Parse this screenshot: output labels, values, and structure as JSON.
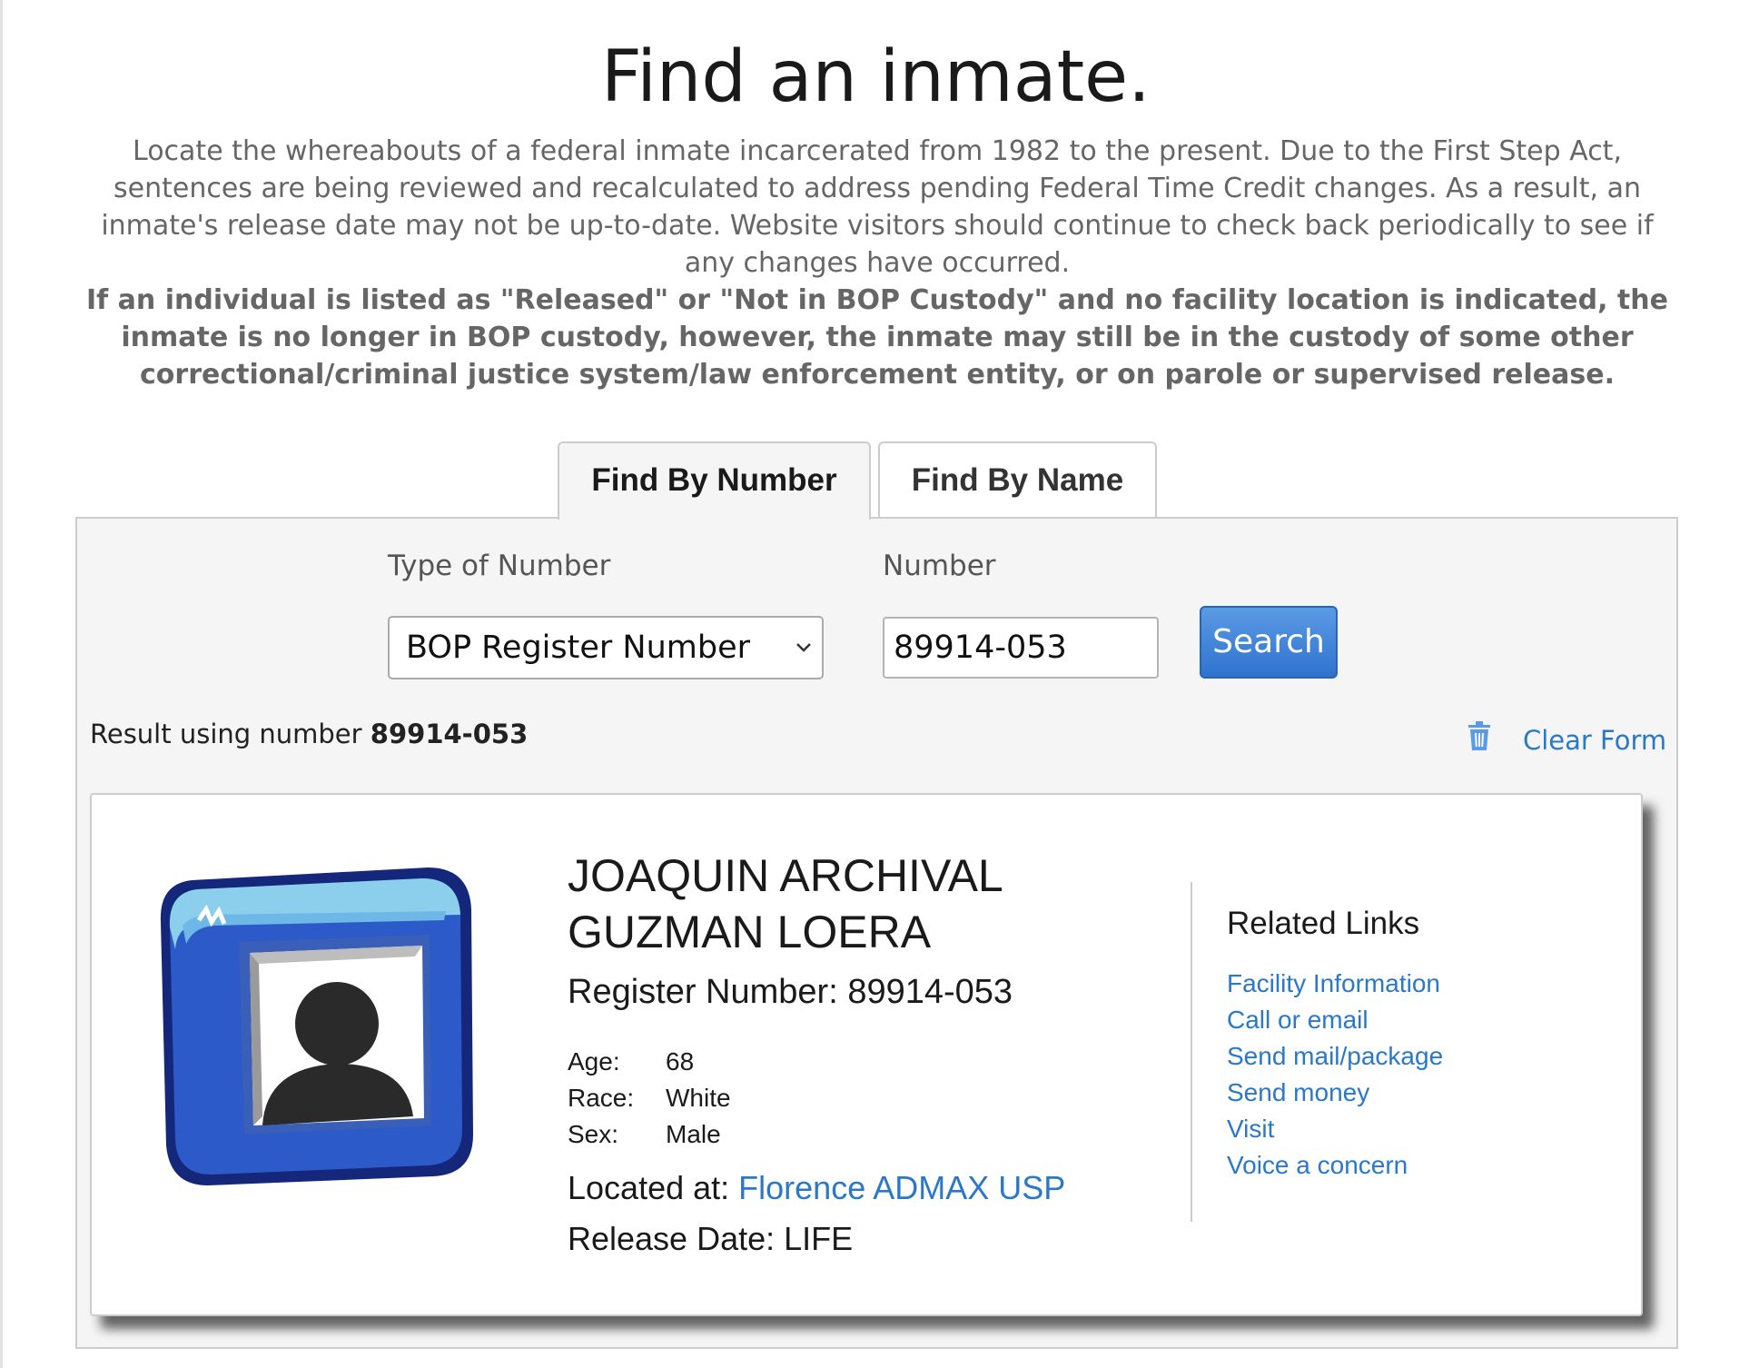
{
  "header": {
    "title": "Find an inmate.",
    "intro": "Locate the whereabouts of a federal inmate incarcerated from 1982 to the present. Due to the First Step Act, sentences are being reviewed and recalculated to address pending Federal Time Credit changes. As a result, an inmate's release date may not be up-to-date. Website visitors should continue to check back periodically to see if any changes have occurred.",
    "notice": "If an individual is listed as \"Released\" or \"Not in BOP Custody\" and no facility location is indicated, the inmate is no longer in BOP custody, however, the inmate may still be in the custody of some other correctional/criminal justice system/law enforcement entity, or on parole or supervised release."
  },
  "tabs": [
    {
      "label": "Find By Number",
      "active": true
    },
    {
      "label": "Find By Name",
      "active": false
    }
  ],
  "form": {
    "type_label": "Type of Number",
    "type_value": "BOP Register Number",
    "number_label": "Number",
    "number_value": "89914-053",
    "search_label": "Search"
  },
  "result": {
    "prefix": "Result using number",
    "number": "89914-053",
    "clear_label": "Clear Form"
  },
  "inmate": {
    "name_line1": "JOAQUIN ARCHIVAL",
    "name_line2": "GUZMAN LOERA",
    "register_label": "Register Number:",
    "register_number": "89914-053",
    "attributes": [
      {
        "key": "Age:",
        "value": "68"
      },
      {
        "key": "Race:",
        "value": "White"
      },
      {
        "key": "Sex:",
        "value": "Male"
      }
    ],
    "located_label": "Located at:",
    "located_value": "Florence ADMAX USP",
    "release_label": "Release Date:",
    "release_value": "LIFE"
  },
  "related": {
    "title": "Related Links",
    "links": [
      "Facility Information",
      "Call or email",
      "Send mail/package",
      "Send money",
      "Visit",
      "Voice a concern"
    ]
  },
  "icons": {
    "avatar": "person-placeholder-icon",
    "select_arrow": "chevron-down-icon",
    "clear": "trash-icon"
  },
  "colors": {
    "link": "#2a78c8",
    "search_button": "#3b80d8",
    "panel_bg": "#f5f5f5",
    "body_text": "#666666"
  }
}
